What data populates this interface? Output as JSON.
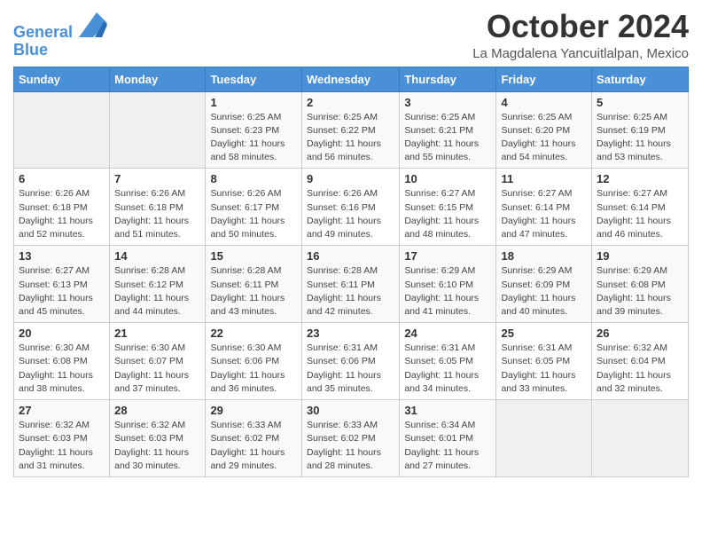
{
  "logo": {
    "line1": "General",
    "line2": "Blue"
  },
  "title": "October 2024",
  "location": "La Magdalena Yancuitlalpan, Mexico",
  "days_of_week": [
    "Sunday",
    "Monday",
    "Tuesday",
    "Wednesday",
    "Thursday",
    "Friday",
    "Saturday"
  ],
  "weeks": [
    [
      {
        "day": "",
        "info": ""
      },
      {
        "day": "",
        "info": ""
      },
      {
        "day": "1",
        "info": "Sunrise: 6:25 AM\nSunset: 6:23 PM\nDaylight: 11 hours and 58 minutes."
      },
      {
        "day": "2",
        "info": "Sunrise: 6:25 AM\nSunset: 6:22 PM\nDaylight: 11 hours and 56 minutes."
      },
      {
        "day": "3",
        "info": "Sunrise: 6:25 AM\nSunset: 6:21 PM\nDaylight: 11 hours and 55 minutes."
      },
      {
        "day": "4",
        "info": "Sunrise: 6:25 AM\nSunset: 6:20 PM\nDaylight: 11 hours and 54 minutes."
      },
      {
        "day": "5",
        "info": "Sunrise: 6:25 AM\nSunset: 6:19 PM\nDaylight: 11 hours and 53 minutes."
      }
    ],
    [
      {
        "day": "6",
        "info": "Sunrise: 6:26 AM\nSunset: 6:18 PM\nDaylight: 11 hours and 52 minutes."
      },
      {
        "day": "7",
        "info": "Sunrise: 6:26 AM\nSunset: 6:18 PM\nDaylight: 11 hours and 51 minutes."
      },
      {
        "day": "8",
        "info": "Sunrise: 6:26 AM\nSunset: 6:17 PM\nDaylight: 11 hours and 50 minutes."
      },
      {
        "day": "9",
        "info": "Sunrise: 6:26 AM\nSunset: 6:16 PM\nDaylight: 11 hours and 49 minutes."
      },
      {
        "day": "10",
        "info": "Sunrise: 6:27 AM\nSunset: 6:15 PM\nDaylight: 11 hours and 48 minutes."
      },
      {
        "day": "11",
        "info": "Sunrise: 6:27 AM\nSunset: 6:14 PM\nDaylight: 11 hours and 47 minutes."
      },
      {
        "day": "12",
        "info": "Sunrise: 6:27 AM\nSunset: 6:14 PM\nDaylight: 11 hours and 46 minutes."
      }
    ],
    [
      {
        "day": "13",
        "info": "Sunrise: 6:27 AM\nSunset: 6:13 PM\nDaylight: 11 hours and 45 minutes."
      },
      {
        "day": "14",
        "info": "Sunrise: 6:28 AM\nSunset: 6:12 PM\nDaylight: 11 hours and 44 minutes."
      },
      {
        "day": "15",
        "info": "Sunrise: 6:28 AM\nSunset: 6:11 PM\nDaylight: 11 hours and 43 minutes."
      },
      {
        "day": "16",
        "info": "Sunrise: 6:28 AM\nSunset: 6:11 PM\nDaylight: 11 hours and 42 minutes."
      },
      {
        "day": "17",
        "info": "Sunrise: 6:29 AM\nSunset: 6:10 PM\nDaylight: 11 hours and 41 minutes."
      },
      {
        "day": "18",
        "info": "Sunrise: 6:29 AM\nSunset: 6:09 PM\nDaylight: 11 hours and 40 minutes."
      },
      {
        "day": "19",
        "info": "Sunrise: 6:29 AM\nSunset: 6:08 PM\nDaylight: 11 hours and 39 minutes."
      }
    ],
    [
      {
        "day": "20",
        "info": "Sunrise: 6:30 AM\nSunset: 6:08 PM\nDaylight: 11 hours and 38 minutes."
      },
      {
        "day": "21",
        "info": "Sunrise: 6:30 AM\nSunset: 6:07 PM\nDaylight: 11 hours and 37 minutes."
      },
      {
        "day": "22",
        "info": "Sunrise: 6:30 AM\nSunset: 6:06 PM\nDaylight: 11 hours and 36 minutes."
      },
      {
        "day": "23",
        "info": "Sunrise: 6:31 AM\nSunset: 6:06 PM\nDaylight: 11 hours and 35 minutes."
      },
      {
        "day": "24",
        "info": "Sunrise: 6:31 AM\nSunset: 6:05 PM\nDaylight: 11 hours and 34 minutes."
      },
      {
        "day": "25",
        "info": "Sunrise: 6:31 AM\nSunset: 6:05 PM\nDaylight: 11 hours and 33 minutes."
      },
      {
        "day": "26",
        "info": "Sunrise: 6:32 AM\nSunset: 6:04 PM\nDaylight: 11 hours and 32 minutes."
      }
    ],
    [
      {
        "day": "27",
        "info": "Sunrise: 6:32 AM\nSunset: 6:03 PM\nDaylight: 11 hours and 31 minutes."
      },
      {
        "day": "28",
        "info": "Sunrise: 6:32 AM\nSunset: 6:03 PM\nDaylight: 11 hours and 30 minutes."
      },
      {
        "day": "29",
        "info": "Sunrise: 6:33 AM\nSunset: 6:02 PM\nDaylight: 11 hours and 29 minutes."
      },
      {
        "day": "30",
        "info": "Sunrise: 6:33 AM\nSunset: 6:02 PM\nDaylight: 11 hours and 28 minutes."
      },
      {
        "day": "31",
        "info": "Sunrise: 6:34 AM\nSunset: 6:01 PM\nDaylight: 11 hours and 27 minutes."
      },
      {
        "day": "",
        "info": ""
      },
      {
        "day": "",
        "info": ""
      }
    ]
  ]
}
